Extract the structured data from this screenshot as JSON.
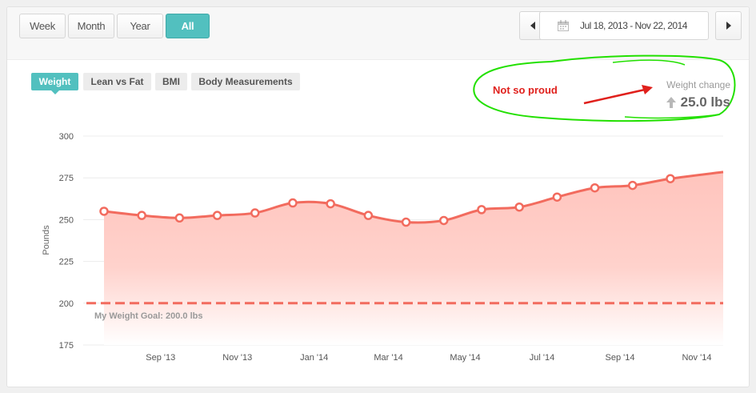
{
  "range_buttons": [
    {
      "label": "Week",
      "active": false
    },
    {
      "label": "Month",
      "active": false
    },
    {
      "label": "Year",
      "active": false
    },
    {
      "label": "All",
      "active": true
    }
  ],
  "date_range": "Jul 18, 2013 - Nov 22, 2014",
  "tabs": [
    {
      "label": "Weight",
      "active": true
    },
    {
      "label": "Lean vs Fat",
      "active": false
    },
    {
      "label": "BMI",
      "active": false
    },
    {
      "label": "Body Measurements",
      "active": false
    }
  ],
  "annotation": {
    "text": "Not so proud",
    "color": "#e0201c",
    "outline_color": "#22e000"
  },
  "weight_change": {
    "label": "Weight change",
    "value": "25.0 lbs",
    "direction": "up"
  },
  "colors": {
    "accent": "#52c0bf",
    "series": "#f26b5e",
    "area": "#ffc9c3"
  },
  "icons": {
    "prev": "chevron-left-icon",
    "next": "chevron-right-icon",
    "calendar": "calendar-icon",
    "change": "arrow-up-icon"
  },
  "chart_data": {
    "type": "area",
    "ylabel": "Pounds",
    "ylim": [
      175,
      300
    ],
    "yticks": [
      "175",
      "200",
      "225",
      "250",
      "275",
      "300"
    ],
    "xticks": [
      {
        "date": "2013-09-01",
        "label": "Sep '13"
      },
      {
        "date": "2013-11-01",
        "label": "Nov '13"
      },
      {
        "date": "2014-01-01",
        "label": "Jan '14"
      },
      {
        "date": "2014-03-01",
        "label": "Mar '14"
      },
      {
        "date": "2014-05-01",
        "label": "May '14"
      },
      {
        "date": "2014-07-01",
        "label": "Jul '14"
      },
      {
        "date": "2014-09-01",
        "label": "Sep '14"
      },
      {
        "date": "2014-11-01",
        "label": "Nov '14"
      }
    ],
    "series": [
      {
        "points": [
          {
            "date": "2013-07-18",
            "value": 255
          },
          {
            "date": "2013-08-17",
            "value": 252.5
          },
          {
            "date": "2013-09-16",
            "value": 251
          },
          {
            "date": "2013-10-16",
            "value": 252.5
          },
          {
            "date": "2013-11-15",
            "value": 254
          },
          {
            "date": "2013-12-15",
            "value": 260
          },
          {
            "date": "2014-01-14",
            "value": 259.5
          },
          {
            "date": "2014-02-13",
            "value": 252.5
          },
          {
            "date": "2014-03-15",
            "value": 248.5
          },
          {
            "date": "2014-04-14",
            "value": 249.5
          },
          {
            "date": "2014-05-14",
            "value": 256
          },
          {
            "date": "2014-06-13",
            "value": 257.5
          },
          {
            "date": "2014-07-13",
            "value": 263.5
          },
          {
            "date": "2014-08-12",
            "value": 269
          },
          {
            "date": "2014-09-11",
            "value": 270.5
          },
          {
            "date": "2014-10-11",
            "value": 274.5
          },
          {
            "date": "2014-11-22",
            "value": 278.5
          }
        ]
      }
    ],
    "goal": {
      "value": 200,
      "label": "My Weight Goal: 200.0 lbs"
    },
    "grid": true,
    "legend": "none"
  }
}
